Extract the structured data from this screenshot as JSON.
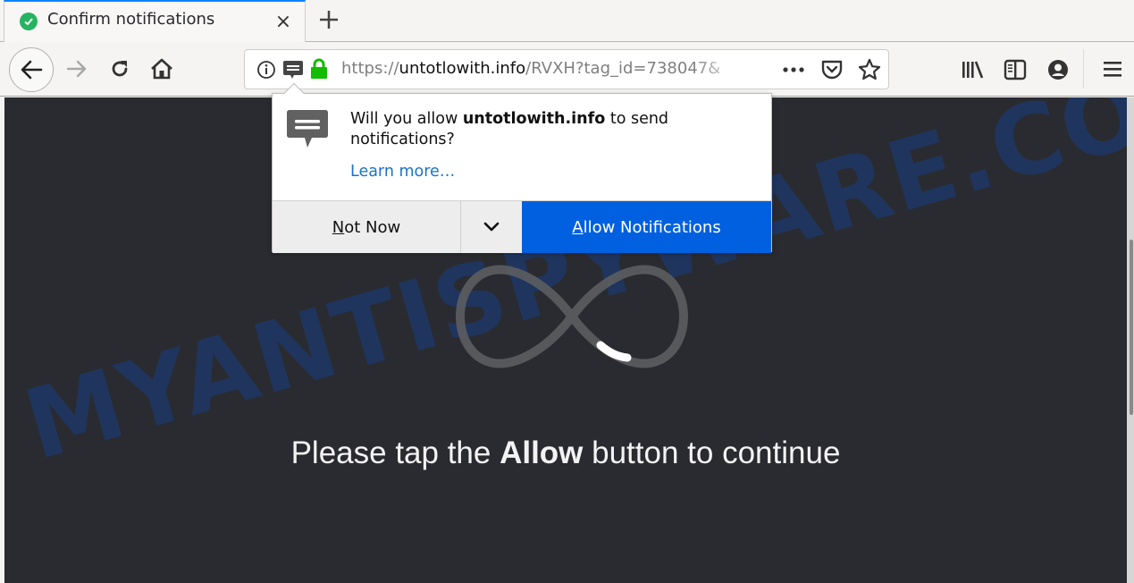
{
  "tab": {
    "title": "Confirm notifications",
    "favicon": "check-circle-icon",
    "close_label": "×",
    "new_tab_label": "+"
  },
  "navbar": {
    "back": "back-arrow-icon",
    "forward": "forward-arrow-icon",
    "reload": "reload-icon",
    "home": "home-icon"
  },
  "urlbar": {
    "scheme": "https://",
    "domain": "untotlowith.info",
    "path": "/RVXH?tag_id=738047&",
    "icons": [
      "info-icon",
      "notification-permission-icon",
      "lock-icon"
    ],
    "actions": [
      "more-actions-icon",
      "pocket-icon",
      "bookmark-star-icon"
    ]
  },
  "toolbar_right": [
    "library-icon",
    "sidebar-icon",
    "account-icon",
    "hamburger-menu-icon"
  ],
  "popup": {
    "text_before": "Will you allow ",
    "domain": "untotlowith.info",
    "text_after": " to send notifications?",
    "learn_more": "Learn more…",
    "not_now": {
      "accesskey": "N",
      "rest": "ot Now"
    },
    "allow": {
      "accesskey": "A",
      "rest": "llow Notifications"
    },
    "colors": {
      "allow_bg": "#0060df",
      "link": "#1a73c8"
    }
  },
  "page": {
    "message_before": "Please tap the ",
    "message_bold": "Allow",
    "message_after": " button to continue",
    "background": "#2a2b30"
  },
  "watermark": "MYANTISPYWARE.COM"
}
